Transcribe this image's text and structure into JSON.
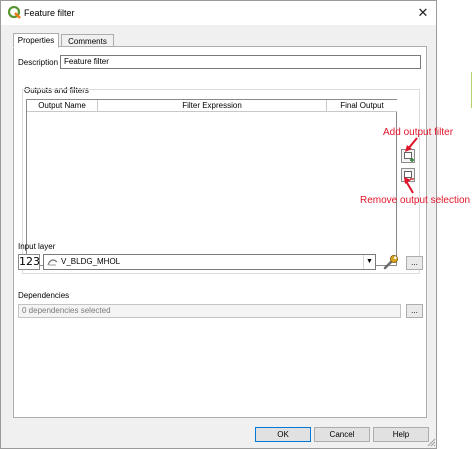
{
  "window": {
    "title": "Feature filter",
    "close_glyph": "✕"
  },
  "tabs": [
    {
      "label": "Properties",
      "active": true
    },
    {
      "label": "Comments",
      "active": false
    }
  ],
  "description": {
    "label": "Description",
    "value": "Feature filter"
  },
  "outputs": {
    "group_title": "Outputs and filters",
    "columns": [
      "Output Name",
      "Filter Expression",
      "Final Output"
    ],
    "rows": [],
    "add_button_icon": "add-filter-icon",
    "remove_button_icon": "remove-filter-icon"
  },
  "input_layer": {
    "label": "Input layer",
    "type_badge": "123",
    "layer_icon": "line-layer-icon",
    "value": "V_BLDG_MHOL",
    "dropdown_glyph": "▼",
    "wrench_icon": "wrench-icon",
    "browse_label": "..."
  },
  "dependencies": {
    "label": "Dependencies",
    "value": "0 dependencies selected",
    "browse_label": "..."
  },
  "footer": {
    "ok": "OK",
    "cancel": "Cancel",
    "help": "Help"
  },
  "annotations": {
    "add_label": "Add output filter",
    "remove_label": "Remove output selection",
    "color": "#e0142a"
  }
}
